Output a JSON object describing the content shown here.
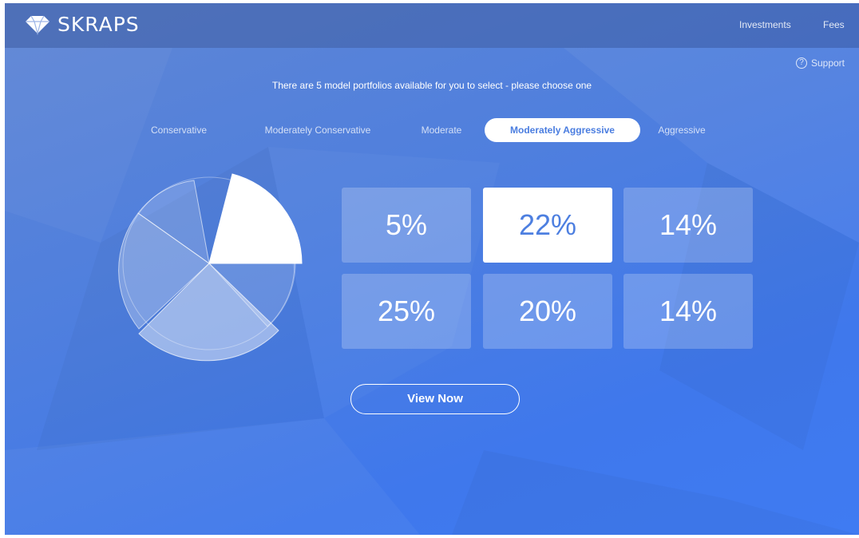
{
  "brand": {
    "name": "SKRAPS",
    "icon": "diamond-icon"
  },
  "nav": {
    "investments": "Investments",
    "fees": "Fees",
    "support": "Support",
    "help_icon_glyph": "?"
  },
  "headline": "There are 5 model portfolios available for you to select - please choose one",
  "tabs": [
    {
      "label": "Conservative",
      "active": false
    },
    {
      "label": "Moderately Conservative",
      "active": false
    },
    {
      "label": "Moderate",
      "active": false
    },
    {
      "label": "Moderately Aggressive",
      "active": true
    },
    {
      "label": "Aggressive",
      "active": false
    }
  ],
  "allocations": [
    {
      "value": "5%",
      "selected": false
    },
    {
      "value": "22%",
      "selected": true
    },
    {
      "value": "14%",
      "selected": false
    },
    {
      "value": "25%",
      "selected": false
    },
    {
      "value": "20%",
      "selected": false
    },
    {
      "value": "14%",
      "selected": false
    }
  ],
  "cta": {
    "label": "View Now"
  },
  "colors": {
    "accent": "#4d7fe0",
    "background": "#4f7fde",
    "text": "#ffffff"
  }
}
